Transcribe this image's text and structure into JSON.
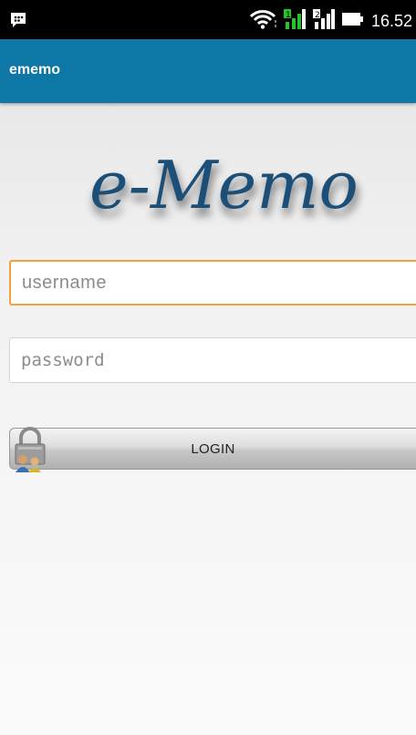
{
  "status_bar": {
    "time": "16.52",
    "icons": [
      "blackberry-messenger-icon",
      "wifi-icon",
      "signal-1-icon",
      "signal-2-icon",
      "battery-icon"
    ]
  },
  "app_bar": {
    "title": "ememo",
    "color": "#0d77a5"
  },
  "logo": {
    "text": "e-Memo"
  },
  "form": {
    "username_placeholder": "username",
    "username_value": "",
    "password_placeholder": "password",
    "password_value": "",
    "login_label": "LOGIN",
    "focus_color": "#f0a33a"
  }
}
